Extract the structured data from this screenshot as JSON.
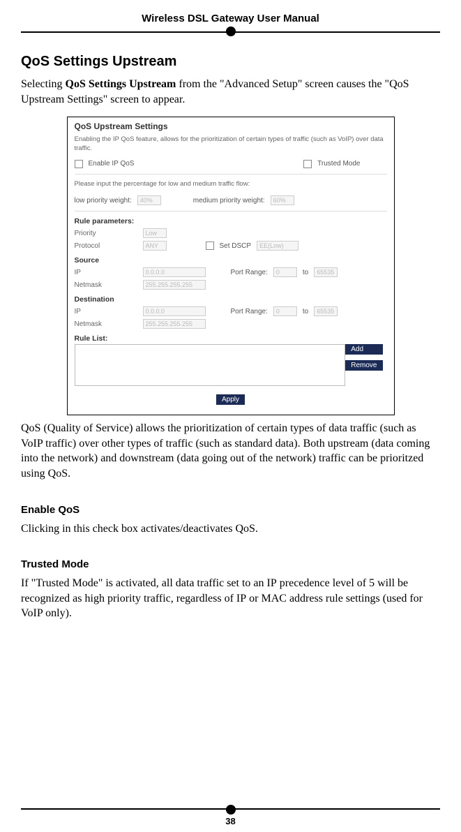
{
  "header": {
    "title": "Wireless DSL Gateway User Manual"
  },
  "section": {
    "title": "QoS Settings Upstream",
    "intro_pre": "Selecting ",
    "intro_bold": "QoS Settings Upstream",
    "intro_post": " from the \"Advanced Setup\" screen causes the \"QoS Upstream Settings\" screen to appear."
  },
  "screenshot": {
    "title": "QoS Upstream Settings",
    "note": "Enabling the IP QoS feature, allows for the prioritization of certain types of traffic (such as VoIP) over data traffic.",
    "enable_label": "Enable IP QoS",
    "trusted_label": "Trusted Mode",
    "percent_note": "Please input the percentage for low and medium traffic flow:",
    "low_label": "low priority weight:",
    "low_value": "40%",
    "med_label": "medium priority weight:",
    "med_value": "60%",
    "rule_params": "Rule parameters:",
    "priority_label": "Priority",
    "priority_value": "Low",
    "protocol_label": "Protocol",
    "protocol_value": "ANY",
    "setdscp_label": "Set DSCP",
    "setdscp_value": "EE(Low)",
    "source": "Source",
    "ip_label": "IP",
    "src_ip": "0.0.0.0",
    "netmask_label": "Netmask",
    "src_nm": "255.255.255.255",
    "port_range": "Port Range:",
    "to": "to",
    "port_a": "0",
    "port_b": "65535",
    "destination": "Destination",
    "dst_ip": "0.0.0.0",
    "dst_nm": "255.255.255.255",
    "dport_a": "0",
    "dport_b": "65535",
    "rule_list": "Rule List:",
    "add": "Add",
    "remove": "Remove",
    "apply": "Apply"
  },
  "desc": "QoS (Quality of Service) allows the prioritization of certain types of data traffic (such as VoIP traffic) over other types of traffic (such as standard data). Both upstream (data coming into the network) and downstream (data going out of the network) traffic can be prioritzed using QoS.",
  "enable": {
    "title": "Enable QoS",
    "text": "Clicking in this check box activates/deactivates QoS."
  },
  "trusted": {
    "title": "Trusted Mode",
    "pre": "If \"Trusted Mode\" is activated, all data traffic set to an ",
    "sc1": "IP",
    "mid1": " precedence level of 5 will be recognized as high priority traffic, regardless of ",
    "sc2": "IP",
    "mid2": " or ",
    "sc3": "MAC",
    "post": " address rule settings (used for VoIP only)."
  },
  "page_number": "38"
}
